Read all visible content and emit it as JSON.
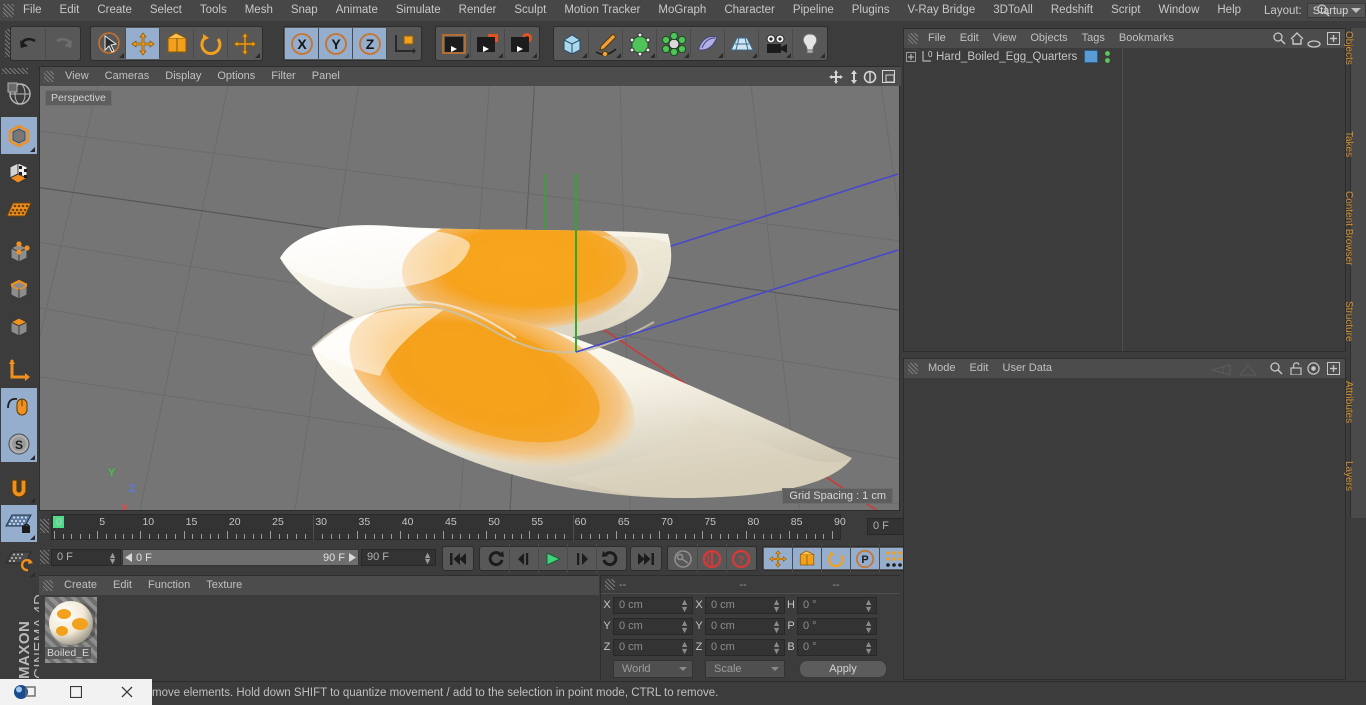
{
  "app": {
    "title": "Cinema 4D",
    "brand_line1": "MAXON",
    "brand_line2": "CINEMA 4D"
  },
  "menubar": {
    "items": [
      {
        "label": "File"
      },
      {
        "label": "Edit"
      },
      {
        "label": "Create"
      },
      {
        "label": "Select"
      },
      {
        "label": "Tools"
      },
      {
        "label": "Mesh"
      },
      {
        "label": "Snap"
      },
      {
        "label": "Animate"
      },
      {
        "label": "Simulate"
      },
      {
        "label": "Render"
      },
      {
        "label": "Sculpt"
      },
      {
        "label": "Motion Tracker"
      },
      {
        "label": "MoGraph"
      },
      {
        "label": "Character"
      },
      {
        "label": "Pipeline"
      },
      {
        "label": "Plugins"
      },
      {
        "label": "V-Ray Bridge"
      },
      {
        "label": "3DToAll"
      },
      {
        "label": "Redshift"
      },
      {
        "label": "Script"
      },
      {
        "label": "Window"
      },
      {
        "label": "Help"
      }
    ],
    "layout_label": "Layout:",
    "layout_value": "Startup"
  },
  "toolbar": {
    "groups": [
      {
        "name": "undo-redo",
        "buttons": [
          {
            "name": "undo-button",
            "icon": "undo-icon",
            "active": false,
            "corner": false
          },
          {
            "name": "redo-button",
            "icon": "redo-icon",
            "active": false,
            "corner": false
          }
        ]
      },
      {
        "name": "tools",
        "buttons": [
          {
            "name": "live-selection-tool",
            "icon": "cursor-select-icon",
            "active": false,
            "corner": true
          },
          {
            "name": "move-tool",
            "icon": "move-icon",
            "active": true,
            "corner": false
          },
          {
            "name": "scale-tool",
            "icon": "scale-icon",
            "active": false,
            "corner": false
          },
          {
            "name": "rotate-tool",
            "icon": "rotate-icon",
            "active": false,
            "corner": false
          },
          {
            "name": "dynamic-place-tool",
            "icon": "move-icon",
            "active": false,
            "corner": true
          }
        ]
      },
      {
        "name": "axis-locks",
        "buttons": [
          {
            "name": "lock-x-axis",
            "icon": "x-axis-icon",
            "active": true,
            "corner": false
          },
          {
            "name": "lock-y-axis",
            "icon": "y-axis-icon",
            "active": true,
            "corner": false
          },
          {
            "name": "lock-z-axis",
            "icon": "z-axis-icon",
            "active": true,
            "corner": false
          },
          {
            "name": "world-object-axis",
            "icon": "world-axis-icon",
            "active": false,
            "corner": false
          }
        ]
      },
      {
        "name": "render",
        "buttons": [
          {
            "name": "render-view-button",
            "icon": "render-view-icon",
            "active": false,
            "corner": true
          },
          {
            "name": "render-to-picture-viewer-button",
            "icon": "render-picture-icon",
            "active": false,
            "corner": true
          },
          {
            "name": "render-settings-button",
            "icon": "render-settings-icon",
            "active": false,
            "corner": true
          }
        ]
      },
      {
        "name": "create-objects",
        "buttons": [
          {
            "name": "cube-primitive-button",
            "icon": "cube-icon",
            "active": false,
            "corner": true
          },
          {
            "name": "spline-pen-button",
            "icon": "pen-icon",
            "active": false,
            "corner": true
          },
          {
            "name": "generator-button",
            "icon": "generator-icon",
            "active": false,
            "corner": true
          },
          {
            "name": "deformer-button",
            "icon": "deformer-icon",
            "active": false,
            "corner": true
          },
          {
            "name": "scene-object-button",
            "icon": "environment-icon",
            "active": false,
            "corner": true
          },
          {
            "name": "floor-button",
            "icon": "floor-grid-icon",
            "active": false,
            "corner": true
          },
          {
            "name": "camera-button",
            "icon": "camera-icon",
            "active": false,
            "corner": true
          },
          {
            "name": "light-button",
            "icon": "light-bulb-icon",
            "active": false,
            "corner": true
          }
        ]
      }
    ]
  },
  "left_toolbar": {
    "buttons": [
      {
        "name": "viewport-render-region",
        "icon": "globe-render-icon",
        "active": false,
        "corner": false
      },
      {
        "name": "model-mode",
        "icon": "model-cube-icon",
        "active": true,
        "corner": true
      },
      {
        "name": "texture-mode",
        "icon": "texture-checker-icon",
        "active": false,
        "corner": false
      },
      {
        "name": "workplane-mode",
        "icon": "workplane-icon",
        "active": false,
        "corner": false
      },
      {
        "name": "points-mode",
        "icon": "points-icon",
        "active": false,
        "corner": false
      },
      {
        "name": "edges-mode",
        "icon": "edges-icon",
        "active": false,
        "corner": false
      },
      {
        "name": "polygons-mode",
        "icon": "polygons-icon",
        "active": false,
        "corner": false
      },
      {
        "name": "enable-axis-modification",
        "icon": "axis-modify-icon",
        "active": false,
        "corner": false
      },
      {
        "name": "viewport-solo-single",
        "icon": "mouse-icon",
        "active": true,
        "corner": false
      },
      {
        "name": "viewport-solo-hierarchy",
        "icon": "soft-selection-icon",
        "active": true,
        "corner": true
      },
      {
        "name": "enable-snapping",
        "icon": "magnet-icon",
        "active": false,
        "corner": true
      },
      {
        "name": "workplane-lock",
        "icon": "workplane-lock-icon",
        "active": true,
        "corner": true
      },
      {
        "name": "planar-workplane",
        "icon": "workplane-rotate-icon",
        "active": false,
        "corner": true
      }
    ]
  },
  "viewport": {
    "menu": [
      {
        "label": "View"
      },
      {
        "label": "Cameras"
      },
      {
        "label": "Display"
      },
      {
        "label": "Options"
      },
      {
        "label": "Filter"
      },
      {
        "label": "Panel"
      }
    ],
    "label": "Perspective",
    "grid_spacing": "Grid Spacing : 1 cm",
    "axis_labels": {
      "x": "X",
      "y": "Y",
      "z": "Z"
    },
    "nav_icons": [
      {
        "name": "pan-view-icon"
      },
      {
        "name": "dolly-view-icon"
      },
      {
        "name": "rotate-view-icon"
      },
      {
        "name": "maximize-view-icon"
      }
    ],
    "background_color": "#757575",
    "object_colors": {
      "egg_white": "#f5f1e6",
      "yolk": "#f4a31e"
    }
  },
  "timeline": {
    "ticks": [
      "0",
      "5",
      "10",
      "15",
      "20",
      "25",
      "30",
      "35",
      "40",
      "45",
      "50",
      "55",
      "60",
      "65",
      "70",
      "75",
      "80",
      "85",
      "90"
    ],
    "min_frame": 0,
    "max_frame": 90,
    "current_frame_value": "0 F",
    "current_frame_field": "0 F",
    "range_start": "0 F",
    "range_end": "90 F",
    "end_frame_field": "90 F"
  },
  "transport": {
    "buttons": [
      {
        "name": "go-to-start-button",
        "icon": "skip-start-icon",
        "active": false
      },
      {
        "name": "previous-key-button",
        "icon": "prev-key-icon",
        "active": false
      },
      {
        "name": "step-back-button",
        "icon": "step-back-icon",
        "active": false
      },
      {
        "name": "play-button",
        "icon": "play-icon",
        "active": false
      },
      {
        "name": "step-forward-button",
        "icon": "step-forward-icon",
        "active": false
      },
      {
        "name": "next-key-button",
        "icon": "next-key-icon",
        "active": false
      },
      {
        "name": "go-to-end-button",
        "icon": "skip-end-icon",
        "active": false
      },
      {
        "name": "record-active-objects-button",
        "icon": "key-icon",
        "active": false
      },
      {
        "name": "autokeying-button",
        "icon": "autokey-icon",
        "active": false
      },
      {
        "name": "keying-help-button",
        "icon": "question-icon",
        "active": false
      },
      {
        "name": "record-position-button",
        "icon": "move-icon",
        "active": true
      },
      {
        "name": "record-scale-button",
        "icon": "scale-icon",
        "active": true
      },
      {
        "name": "record-rotation-button",
        "icon": "rotate-icon",
        "active": true
      },
      {
        "name": "record-pla-button",
        "icon": "pla-icon",
        "active": true
      },
      {
        "name": "parameter-button",
        "icon": "dots-grid-icon",
        "active": true
      },
      {
        "name": "timeline-view-button",
        "icon": "filmstrip-icon",
        "active": true
      }
    ]
  },
  "material_manager": {
    "menu": [
      {
        "label": "Create"
      },
      {
        "label": "Edit"
      },
      {
        "label": "Function"
      },
      {
        "label": "Texture"
      }
    ],
    "materials": [
      {
        "name": "Boiled_E",
        "base_color": "#f3ead6",
        "pattern_color": "#f2a11c"
      }
    ]
  },
  "coordinates": {
    "header": [
      "--",
      "--",
      "--"
    ],
    "rows": [
      {
        "pos_label": "X",
        "pos_value": "0 cm",
        "size_label": "X",
        "size_value": "0 cm",
        "rot_label": "H",
        "rot_value": "0 °"
      },
      {
        "pos_label": "Y",
        "pos_value": "0 cm",
        "size_label": "Y",
        "size_value": "0 cm",
        "rot_label": "P",
        "rot_value": "0 °"
      },
      {
        "pos_label": "Z",
        "pos_value": "0 cm",
        "size_label": "Z",
        "size_value": "0 cm",
        "rot_label": "B",
        "rot_value": "0 °"
      }
    ],
    "coord_system": "World",
    "size_mode": "Scale",
    "apply_label": "Apply"
  },
  "object_manager": {
    "menu": [
      {
        "label": "File"
      },
      {
        "label": "Edit"
      },
      {
        "label": "View"
      },
      {
        "label": "Objects"
      },
      {
        "label": "Tags"
      },
      {
        "label": "Bookmarks"
      }
    ],
    "header_icons": [
      {
        "name": "search-icon"
      },
      {
        "name": "home-icon"
      },
      {
        "name": "ellipse-icon"
      },
      {
        "name": "plus-box-icon"
      }
    ],
    "objects": [
      {
        "name": "Hard_Boiled_Egg_Quarters",
        "layer_badge": "0",
        "tag_color": "#5b9bd5",
        "visibility_dots": [
          "#5cc65c",
          "#5cc65c"
        ]
      }
    ],
    "side_tabs": [
      "Objects",
      "Takes",
      "Content Browser",
      "Structure"
    ]
  },
  "attribute_manager": {
    "menu": [
      {
        "label": "Mode"
      },
      {
        "label": "Edit"
      },
      {
        "label": "User Data"
      }
    ],
    "header_icons": [
      {
        "name": "back-arrow-icon"
      },
      {
        "name": "forward-arrow-icon"
      },
      {
        "name": "search-icon"
      },
      {
        "name": "lock-icon"
      },
      {
        "name": "target-icon"
      },
      {
        "name": "plus-box-icon"
      }
    ],
    "side_tabs": [
      "Attributes",
      "Layers"
    ]
  },
  "status_bar": {
    "message": "move elements. Hold down SHIFT to quantize movement / add to the selection in point mode, CTRL to remove."
  },
  "taskbar": {
    "buttons": [
      {
        "name": "app-icon",
        "icon": "c4d-logo-icon"
      },
      {
        "name": "restore-window-button",
        "icon": "restore-icon"
      },
      {
        "name": "maximize-window-button",
        "icon": "maximize-icon"
      },
      {
        "name": "close-window-button",
        "icon": "close-icon"
      }
    ]
  }
}
